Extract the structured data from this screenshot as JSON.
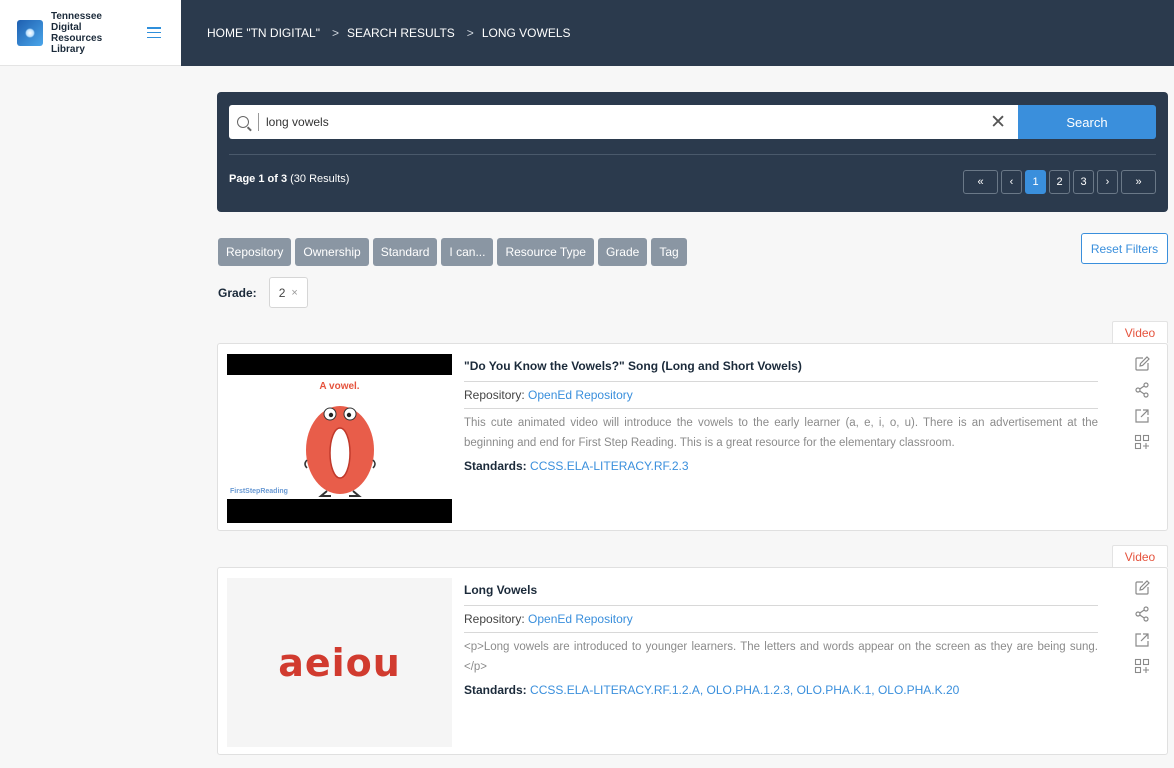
{
  "brand": {
    "name_line1": "Tennessee Digital",
    "name_line2": "Resources Library"
  },
  "breadcrumb": {
    "home": "HOME \"TN DIGITAL\"",
    "search": "SEARCH RESULTS",
    "current": "LONG VOWELS",
    "separator": ">"
  },
  "search": {
    "value": "long vowels",
    "clear_label": "✕",
    "button_label": "Search"
  },
  "results": {
    "page_label": "Page 1 of 3",
    "count_label": "(30 Results)"
  },
  "pagination": {
    "first": "«",
    "prev": "‹",
    "pages": [
      "1",
      "2",
      "3"
    ],
    "active_page": "1",
    "next": "›",
    "last": "»"
  },
  "filters": [
    "Repository",
    "Ownership",
    "Standard",
    "I can...",
    "Resource Type",
    "Grade",
    "Tag"
  ],
  "reset_filters_label": "Reset Filters",
  "active_filter": {
    "label": "Grade:",
    "value": "2",
    "remove": "×"
  },
  "items": [
    {
      "type": "Video",
      "title": "\"Do You Know the Vowels?\" Song (Long and Short Vowels)",
      "repository_label": "Repository:",
      "repository": "OpenEd Repository",
      "description": "This cute animated video will introduce the vowels to the early learner (a, e, i, o, u). There is an advertisement at the beginning and end for First Step Reading. This is a great resource for the elementary classroom.",
      "standards_label": "Standards:",
      "standards": "CCSS.ELA-LITERACY.RF.2.3",
      "thumb_caption": "A vowel.",
      "thumb_watermark": "FirstStepReading"
    },
    {
      "type": "Video",
      "title": "Long Vowels",
      "repository_label": "Repository:",
      "repository": "OpenEd Repository",
      "description": "<p>Long vowels are introduced to younger learners. The letters and words appear on the screen as they are being sung.</p>",
      "standards_label": "Standards:",
      "standards": "CCSS.ELA-LITERACY.RF.1.2.A, OLO.PHA.1.2.3, OLO.PHA.K.1, OLO.PHA.K.20",
      "thumb_text": "aeiou"
    }
  ],
  "colors": {
    "accent": "#3a8fdc",
    "header": "#2b3a4d",
    "type_tag": "#e5533d",
    "filter_chip": "#8a96a3"
  },
  "icons": [
    "search-icon",
    "clear-icon",
    "edit-icon",
    "share-icon",
    "open-external-icon",
    "add-collection-icon",
    "hamburger-icon"
  ]
}
